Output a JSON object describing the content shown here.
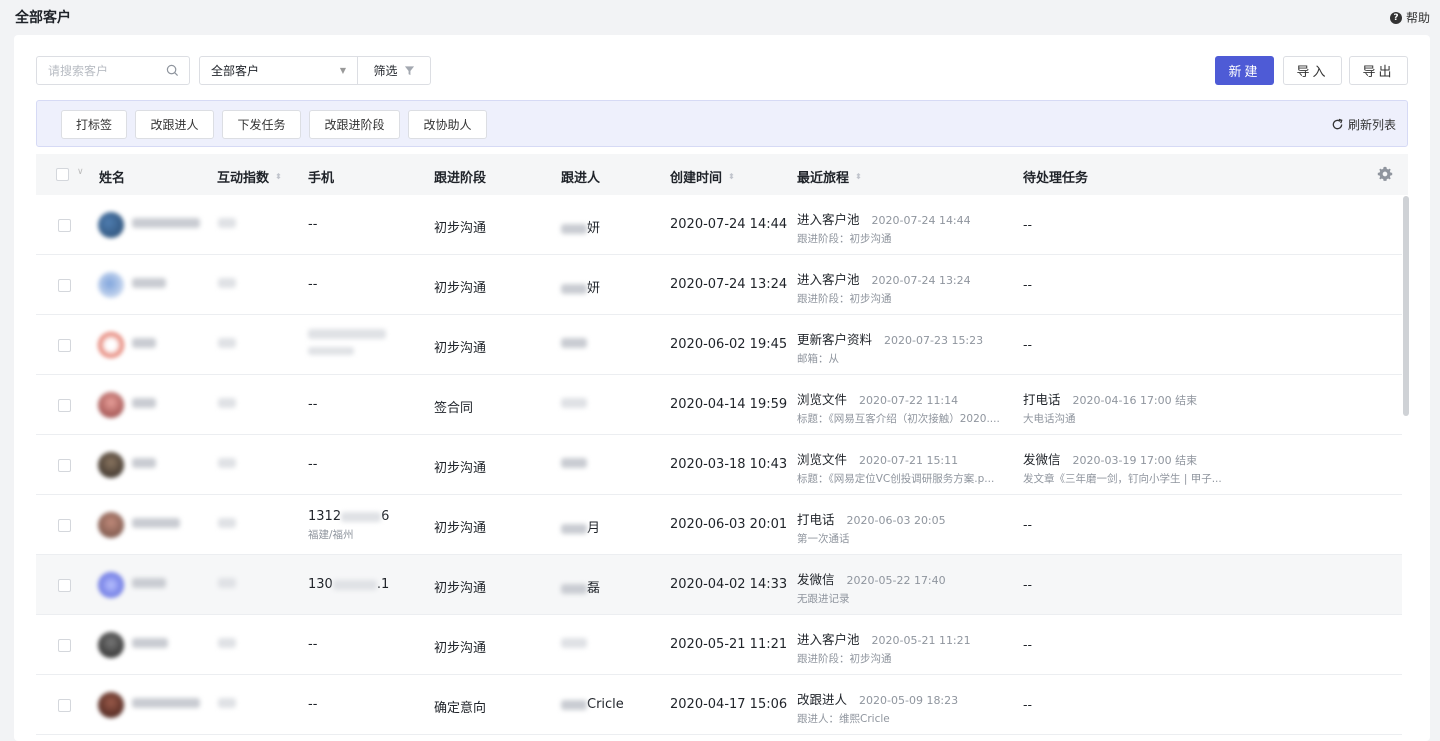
{
  "header": {
    "title": "全部客户",
    "help_label": "帮助"
  },
  "toolbar": {
    "search_placeholder": "请搜索客户",
    "scope_select": "全部客户",
    "filter_label": "筛选",
    "new_label": "新建",
    "import_label": "导入",
    "export_label": "导出"
  },
  "actions": {
    "buttons": [
      "打标签",
      "改跟进人",
      "下发任务",
      "改跟进阶段",
      "改协助人"
    ],
    "refresh_label": "刷新列表"
  },
  "columns": [
    "姓名",
    "互动指数",
    "手机",
    "跟进阶段",
    "跟进人",
    "创建时间",
    "最近旅程",
    "待处理任务"
  ],
  "rows": [
    {
      "phone": "--",
      "phone_sub": "",
      "stage": "初步沟通",
      "follower_suffix": "妍",
      "created": "2020-07-24 14:44",
      "journey_title": "进入客户池",
      "journey_time": "2020-07-24 14:44",
      "journey_detail": "跟进阶段：初步沟通",
      "task_title": "--",
      "task_time": "",
      "task_detail": ""
    },
    {
      "phone": "--",
      "phone_sub": "",
      "stage": "初步沟通",
      "follower_suffix": "妍",
      "created": "2020-07-24 13:24",
      "journey_title": "进入客户池",
      "journey_time": "2020-07-24 13:24",
      "journey_detail": "跟进阶段：初步沟通",
      "task_title": "--",
      "task_time": "",
      "task_detail": ""
    },
    {
      "phone": "",
      "phone_sub": "",
      "stage": "初步沟通",
      "follower_suffix": "",
      "created": "2020-06-02 19:45",
      "journey_title": "更新客户资料",
      "journey_time": "2020-07-23 15:23",
      "journey_detail": "邮箱：从",
      "task_title": "--",
      "task_time": "",
      "task_detail": ""
    },
    {
      "phone": "--",
      "phone_sub": "",
      "stage": "签合同",
      "follower_suffix": "",
      "created": "2020-04-14 19:59",
      "journey_title": "浏览文件",
      "journey_time": "2020-07-22 11:14",
      "journey_detail": "标题：《网易互客介绍（初次接触）2020....",
      "task_title": "打电话",
      "task_time": "2020-04-16 17:00 结束",
      "task_detail": "大电话沟通"
    },
    {
      "phone": "--",
      "phone_sub": "",
      "stage": "初步沟通",
      "follower_suffix": "",
      "created": "2020-03-18 10:43",
      "journey_title": "浏览文件",
      "journey_time": "2020-07-21 15:11",
      "journey_detail": "标题：《网易定位VC创投调研服务方案.p...",
      "task_title": "发微信",
      "task_time": "2020-03-19 17:00 结束",
      "task_detail": "发文章《三年磨一剑，钉向小学生 | 甲子..."
    },
    {
      "phone": "1312",
      "phone_tail": "6",
      "phone_sub": "福建/福州",
      "stage": "初步沟通",
      "follower_suffix": "月",
      "created": "2020-06-03 20:01",
      "journey_title": "打电话",
      "journey_time": "2020-06-03 20:05",
      "journey_detail": "第一次通话",
      "task_title": "--",
      "task_time": "",
      "task_detail": ""
    },
    {
      "phone": "130",
      "phone_tail": ".1",
      "phone_sub": "",
      "stage": "初步沟通",
      "follower_suffix": "磊",
      "created": "2020-04-02 14:33",
      "journey_title": "发微信",
      "journey_time": "2020-05-22 17:40",
      "journey_detail": "无跟进记录",
      "task_title": "--",
      "task_time": "",
      "task_detail": ""
    },
    {
      "phone": "--",
      "phone_sub": "",
      "stage": "初步沟通",
      "follower_suffix": "",
      "created": "2020-05-21 11:21",
      "journey_title": "进入客户池",
      "journey_time": "2020-05-21 11:21",
      "journey_detail": "跟进阶段：初步沟通",
      "task_title": "--",
      "task_time": "",
      "task_detail": ""
    },
    {
      "phone": "--",
      "phone_sub": "",
      "stage": "确定意向",
      "follower_suffix": "Cricle",
      "created": "2020-04-17 15:06",
      "journey_title": "改跟进人",
      "journey_time": "2020-05-09 18:23",
      "journey_detail": "跟进人：维熙Cricle",
      "task_title": "--",
      "task_time": "",
      "task_detail": ""
    }
  ],
  "colors": {
    "primary": "#4e5bd6",
    "action_bar_bg": "#eef0fc",
    "header_bg": "#f5f6f7"
  },
  "icons": [
    "help-icon",
    "search-icon",
    "filter-icon",
    "refresh-icon",
    "settings-gear-icon"
  ]
}
